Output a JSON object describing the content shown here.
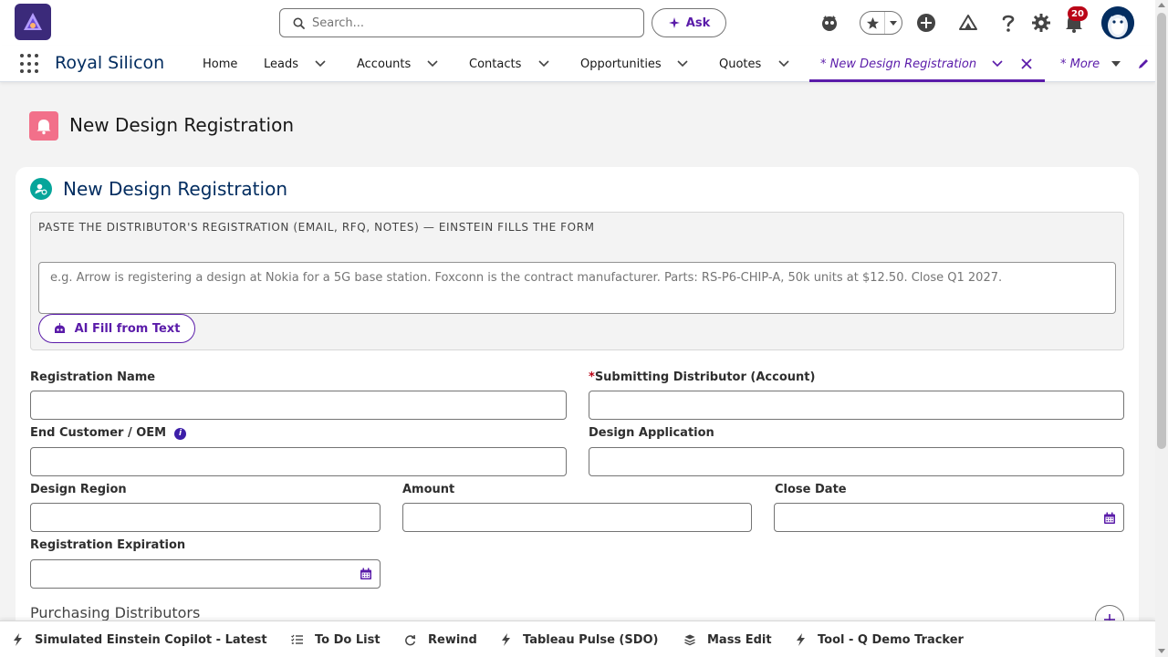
{
  "header": {
    "search": {
      "placeholder": "Search..."
    },
    "ask_label": "Ask",
    "notification_count": "20",
    "icons": [
      "einstein-icon",
      "favorites-star-icon",
      "chevron-down-icon",
      "add-icon",
      "trailhead-icon",
      "help-icon",
      "setup-gear-icon",
      "notification-bell-icon",
      "avatar"
    ]
  },
  "nav": {
    "app_name": "Royal Silicon",
    "items": [
      {
        "label": "Home"
      },
      {
        "label": "Leads"
      },
      {
        "label": "Accounts"
      },
      {
        "label": "Contacts"
      },
      {
        "label": "Opportunities"
      },
      {
        "label": "Quotes"
      }
    ],
    "active_tab": {
      "label": "* New Design Registration"
    },
    "more_label": "* More"
  },
  "page": {
    "title": "New Design Registration"
  },
  "card": {
    "title": "New Design Registration",
    "paste_panel": {
      "label": "PASTE THE DISTRIBUTOR'S REGISTRATION (EMAIL, RFQ, NOTES) — EINSTEIN FILLS THE FORM",
      "placeholder": "e.g. Arrow is registering a design at Nokia for a 5G base station. Foxconn is the contract manufacturer. Parts: RS-P6-CHIP-A, 50k units at $12.50. Close Q1 2027.",
      "button_label": "AI Fill from Text"
    },
    "fields": {
      "registration_name": {
        "label": "Registration Name",
        "value": ""
      },
      "submitting_distributor": {
        "required_mark": "*",
        "label": "Submitting Distributor (Account)",
        "value": ""
      },
      "end_customer": {
        "label": "End Customer / OEM",
        "value": ""
      },
      "design_application": {
        "label": "Design Application",
        "value": ""
      },
      "design_region": {
        "label": "Design Region",
        "value": ""
      },
      "amount": {
        "label": "Amount",
        "value": ""
      },
      "close_date": {
        "label": "Close Date",
        "value": ""
      },
      "registration_expiration": {
        "label": "Registration Expiration",
        "value": ""
      }
    },
    "section_purchasing": "Purchasing Distributors"
  },
  "utility_bar": {
    "items": [
      {
        "label": "Simulated Einstein Copilot - Latest",
        "icon": "lightning-icon"
      },
      {
        "label": "To Do List",
        "icon": "checklist-icon"
      },
      {
        "label": "Rewind",
        "icon": "refresh-icon"
      },
      {
        "label": "Tableau Pulse (SDO)",
        "icon": "lightning-icon"
      },
      {
        "label": "Mass Edit",
        "icon": "layers-icon"
      },
      {
        "label": "Tool - Q Demo Tracker",
        "icon": "lightning-icon"
      }
    ]
  },
  "colors": {
    "brand": "#5a1ba9",
    "app_name": "#032d60",
    "page_icon": "#f2708a",
    "card_icon": "#06a59a",
    "required": "#ba0517",
    "badge": "#ba0517"
  }
}
